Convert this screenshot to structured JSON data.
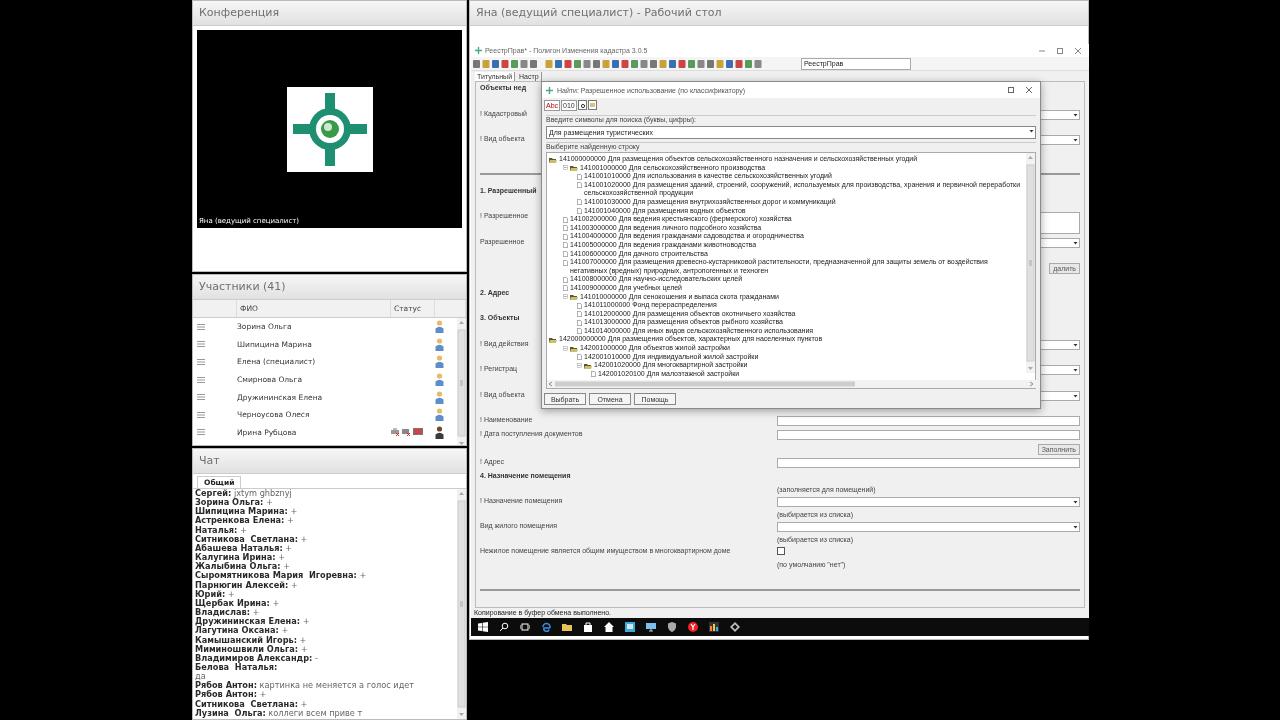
{
  "conference": {
    "title": "Конференция",
    "caption": "Яна (ведущий специалист)"
  },
  "participants": {
    "title": "Участники (41)",
    "columns": [
      "ФИО",
      "Статус"
    ],
    "rows": [
      {
        "name": "Зорина Ольга",
        "status_icons": false
      },
      {
        "name": "Шипицина Марина",
        "status_icons": false
      },
      {
        "name": "Елена (специалист)",
        "status_icons": false
      },
      {
        "name": "Смирнова Ольга",
        "status_icons": false
      },
      {
        "name": "Дружининская Елена",
        "status_icons": false
      },
      {
        "name": "Черноусова Олеся",
        "status_icons": false
      },
      {
        "name": "Ирина Рубцова",
        "status_icons": true
      }
    ]
  },
  "chat": {
    "title": "Чат",
    "tabs": [
      {
        "label": "Общий",
        "selected": true
      }
    ],
    "messages": [
      {
        "author": "Сергей:",
        "text": "jxtym ghbznyj",
        "kind": "inline"
      },
      {
        "author": "Зорина Ольга:",
        "text": "+",
        "kind": "inline"
      },
      {
        "author": "Шипицина Марина:",
        "text": "+",
        "kind": "inline"
      },
      {
        "author": "Астренкова Елена:",
        "text": "+",
        "kind": "inline"
      },
      {
        "author": "Наталья:",
        "text": "+",
        "kind": "inline"
      },
      {
        "author": "Ситникова  Светлана:",
        "text": "+",
        "kind": "inline"
      },
      {
        "author": "Абашева Наталья:",
        "text": "+",
        "kind": "inline"
      },
      {
        "author": "Калугина Ирина:",
        "text": "+",
        "kind": "inline"
      },
      {
        "author": "Жалыбина Ольга:",
        "text": "+",
        "kind": "inline"
      },
      {
        "author": "Сыромятникова Мария  Игоревна:",
        "text": "+",
        "kind": "inline"
      },
      {
        "author": "Парнюгин Алексей:",
        "text": "+",
        "kind": "inline"
      },
      {
        "author": "Юрий:",
        "text": "+",
        "kind": "inline"
      },
      {
        "author": "Щербак Ирина:",
        "text": "+",
        "kind": "inline"
      },
      {
        "author": "Владислав:",
        "text": "+",
        "kind": "inline"
      },
      {
        "author": "Дружининская Елена:",
        "text": "+",
        "kind": "inline"
      },
      {
        "author": "Лагутина Оксана:",
        "text": "+",
        "kind": "inline"
      },
      {
        "author": "Камышанский Игорь:",
        "text": "+",
        "kind": "inline"
      },
      {
        "author": "Миминошвили Ольга:",
        "text": "+",
        "kind": "inline"
      },
      {
        "author": "Владимиров Александр:",
        "text": "-",
        "kind": "inline"
      },
      {
        "author": "Белова  Наталья:",
        "text": "да",
        "kind": "block"
      },
      {
        "author": "Рябов Антон:",
        "text": "картинка не меняется а голос идет",
        "kind": "inline"
      },
      {
        "author": "Рябов Антон:",
        "text": "+",
        "kind": "inline"
      },
      {
        "author": "Ситникова  Светлана:",
        "text": "+",
        "kind": "inline"
      },
      {
        "author": "Лузина  Ольга:",
        "text": "коллеги всем приве т",
        "kind": "inline"
      }
    ]
  },
  "desktop": {
    "title": "Яна (ведущий специалист) - Рабочий стол",
    "app": {
      "title": "РеестрПрав* - Полигон Изменения кадастра 3.0.5",
      "toolbar_field": "РеестрПрав",
      "tabs": [
        {
          "label": "Титульный",
          "selected": true
        },
        {
          "label": "Настр",
          "selected": false
        }
      ],
      "form": [
        {
          "kind": "section",
          "label": "Объекты нед"
        },
        {
          "kind": "select",
          "label": "! Кадастровый"
        },
        {
          "kind": "select",
          "label": "! Вид объекта"
        },
        {
          "kind": "rule"
        },
        {
          "kind": "section",
          "label": "1. Разрешенный"
        },
        {
          "kind": "textarea",
          "label": "! Разрешенное"
        },
        {
          "kind": "select",
          "label": "Разрешенное"
        },
        {
          "kind": "button",
          "text": "далить"
        },
        {
          "kind": "section",
          "label": "2. Адрес"
        },
        {
          "kind": "section",
          "label": "3. Объекты"
        },
        {
          "kind": "select",
          "label": "! Вид действия"
        },
        {
          "kind": "select",
          "label": "! Регистрац"
        },
        {
          "kind": "select",
          "label": "! Вид объекта"
        },
        {
          "kind": "input",
          "label": "! Наименование"
        },
        {
          "kind": "input",
          "label": "! Дата поступления документов"
        },
        {
          "kind": "button",
          "text": "Заполнить"
        },
        {
          "kind": "input",
          "label": "! Адрес"
        },
        {
          "kind": "section",
          "label": "4. Назначение помещения"
        },
        {
          "kind": "note",
          "text": "(заполняется для помещений)"
        },
        {
          "kind": "select",
          "label": "! Назначение помещения"
        },
        {
          "kind": "note",
          "text": "(выбирается из списка)"
        },
        {
          "kind": "select",
          "label": "Вид жилого помещения"
        },
        {
          "kind": "note",
          "text": "(выбирается из списка)"
        },
        {
          "kind": "checkbox",
          "label": "Нежилое помещение является общим имуществом в многоквартирном доме",
          "checked": false
        },
        {
          "kind": "note",
          "text": "(по умолчанию \"нет\")"
        }
      ],
      "status": "Копирование в буфер обмена выполнено.",
      "dialog": {
        "title": "Найти: Разрешенное использование (по классификатору)",
        "tools": [
          "Abc",
          "010"
        ],
        "search_label": "Введите символы для поиска (буквы, цифры):",
        "search_value": "Для размещения туристических",
        "tree_label": "Выберите найденную строку",
        "tree": [
          {
            "label": "141000000000 Для размещения объектов сельскохозяйственного назначения и сельскохозяйственных угодий",
            "expanded": true,
            "children": [
              {
                "label": "141001000000 Для сельскохозяйственного производства",
                "expanded": true,
                "children": [
                  {
                    "label": "141001010000 Для использования в качестве сельскохозяйственных угодий"
                  },
                  {
                    "label": "141001020000 Для размещения зданий, строений, сооружений, используемых для производства, хранения и первичной переработки сельскохозяйственной продукции"
                  },
                  {
                    "label": "141001030000 Для размещения внутрихозяйственных дорог и коммуникаций"
                  },
                  {
                    "label": "141001040000 Для размещения водных объектов"
                  }
                ]
              },
              {
                "label": "141002000000 Для ведения крестьянского (фермерского) хозяйства"
              },
              {
                "label": "141003000000 Для ведения личного подсобного хозяйства"
              },
              {
                "label": "141004000000 Для ведения гражданами садоводства и огородничества"
              },
              {
                "label": "141005000000 Для ведения гражданами животноводства"
              },
              {
                "label": "141006000000 Для дачного строительства"
              },
              {
                "label": "141007000000 Для размещения древесно-кустарниковой растительности, предназначенной для защиты земель от воздействия негативных (вредных) природных, антропогенных и техноген"
              },
              {
                "label": "141008000000 Для научно-исследовательских целей"
              },
              {
                "label": "141009000000 Для учебных целей"
              },
              {
                "label": "141010000000 Для сенокошения и выпаса скота гражданами",
                "expanded": true,
                "children": [
                  {
                    "label": "141011000000 Фонд перераспределения"
                  },
                  {
                    "label": "141012000000 Для размещения объектов охотничьего хозяйства"
                  },
                  {
                    "label": "141013000000 Для размещения объектов рыбного хозяйства"
                  },
                  {
                    "label": "141014000000 Для иных видов сельскохозяйственного использования"
                  }
                ]
              }
            ]
          },
          {
            "label": "142000000000 Для размещения объектов, характерных для населенных пунктов",
            "expanded": true,
            "children": [
              {
                "label": "142001000000 Для объектов жилой застройки",
                "expanded": true,
                "children": [
                  {
                    "label": "142001010000 Для индивидуальной жилой застройки"
                  },
                  {
                    "label": "142001020000 Для многоквартирной застройки",
                    "expanded": true,
                    "children": [
                      {
                        "label": "142001020100 Для малоэтажной застройки"
                      }
                    ]
                  }
                ]
              }
            ]
          }
        ],
        "buttons": [
          "Выбрать",
          "Отмена",
          "Помощь"
        ]
      }
    }
  }
}
